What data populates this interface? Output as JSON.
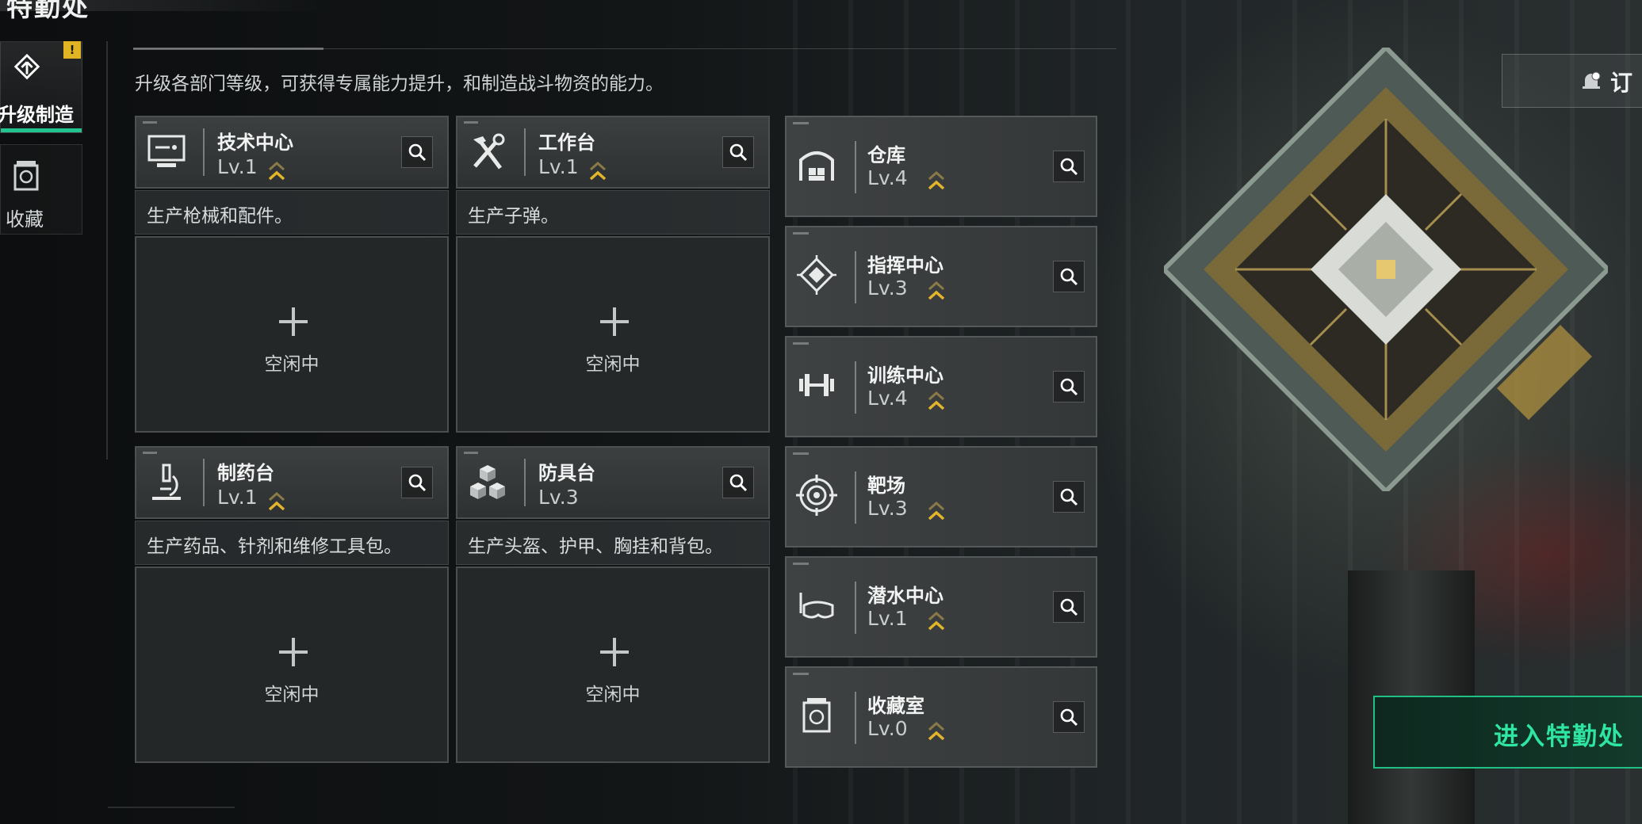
{
  "header": {
    "title": "特勤处",
    "subtitle": "升级各部门等级，可获得专属能力提升，和制造战斗物资的能力。"
  },
  "sidebar": {
    "badge": "!",
    "items": [
      {
        "label": "升级制造",
        "icon": "upgrade-icon",
        "active": true
      },
      {
        "label": "收藏",
        "icon": "collection-icon",
        "active": false
      }
    ]
  },
  "production": [
    {
      "name": "技术中心",
      "level": "Lv.1",
      "description": "生产枪械和配件。",
      "status": "空闲中",
      "icon": "monitor-icon",
      "upgradable": true
    },
    {
      "name": "工作台",
      "level": "Lv.1",
      "description": "生产子弹。",
      "status": "空闲中",
      "icon": "hammer-wrench-icon",
      "upgradable": true
    },
    {
      "name": "制药台",
      "level": "Lv.1",
      "description": "生产药品、针剂和维修工具包。",
      "status": "空闲中",
      "icon": "microscope-icon",
      "upgradable": true
    },
    {
      "name": "防具台",
      "level": "Lv.3",
      "description": "生产头盔、护甲、胸挂和背包。",
      "status": "空闲中",
      "icon": "boxes-icon",
      "upgradable": false
    }
  ],
  "facilities": [
    {
      "name": "仓库",
      "level": "Lv.4",
      "icon": "warehouse-icon"
    },
    {
      "name": "指挥中心",
      "level": "Lv.3",
      "icon": "command-chip-icon"
    },
    {
      "name": "训练中心",
      "level": "Lv.4",
      "icon": "dumbbell-icon"
    },
    {
      "name": "靶场",
      "level": "Lv.3",
      "icon": "target-icon"
    },
    {
      "name": "潜水中心",
      "level": "Lv.1",
      "icon": "diving-mask-icon"
    },
    {
      "name": "收藏室",
      "level": "Lv.0",
      "icon": "collection-room-icon"
    }
  ],
  "buttons": {
    "subscribe": "订",
    "enter": "进入特勤处"
  },
  "colors": {
    "accent_green": "#22c38e",
    "upgrade_arrow": "#e3b52a",
    "alert_badge": "#e0b422"
  }
}
